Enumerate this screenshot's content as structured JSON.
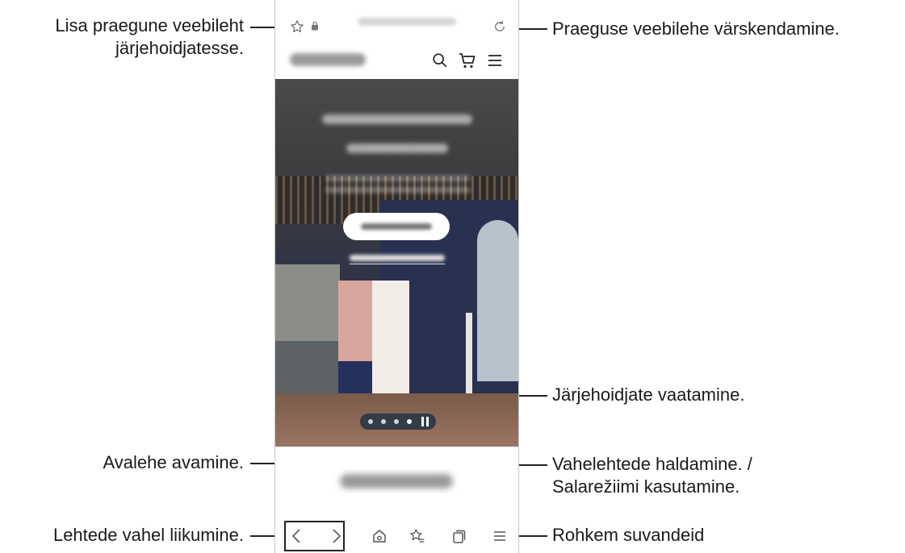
{
  "callouts": {
    "bookmark_add": {
      "line1": "Lisa praegune veebileht",
      "line2": "järjehoidjatesse."
    },
    "refresh": "Praeguse veebilehe värskendamine.",
    "bookmarks_view": "Järjehoidjate vaatamine.",
    "home": "Avalehe avamine.",
    "tabs": {
      "line1": "Vahelehtede haldamine. /",
      "line2": "Salarežiimi kasutamine."
    },
    "navigate": "Lehtede vahel liikumine.",
    "more": "Rohkem suvandeid"
  },
  "browser": {
    "icons": {
      "bookmark_star": "star-icon",
      "lock": "lock-icon",
      "refresh": "refresh-icon",
      "search": "search-icon",
      "cart": "cart-icon",
      "menu": "hamburger-menu-icon",
      "back": "chevron-left-icon",
      "forward": "chevron-right-icon",
      "home": "home-icon",
      "bookmarks": "bookmarks-star-list-icon",
      "tabs": "tabs-icon",
      "more": "more-menu-icon"
    },
    "carousel": {
      "total": 4,
      "current": 4
    }
  },
  "colors": {
    "text": "#1a1a1a",
    "icon": "#555555",
    "line": "#222222"
  }
}
